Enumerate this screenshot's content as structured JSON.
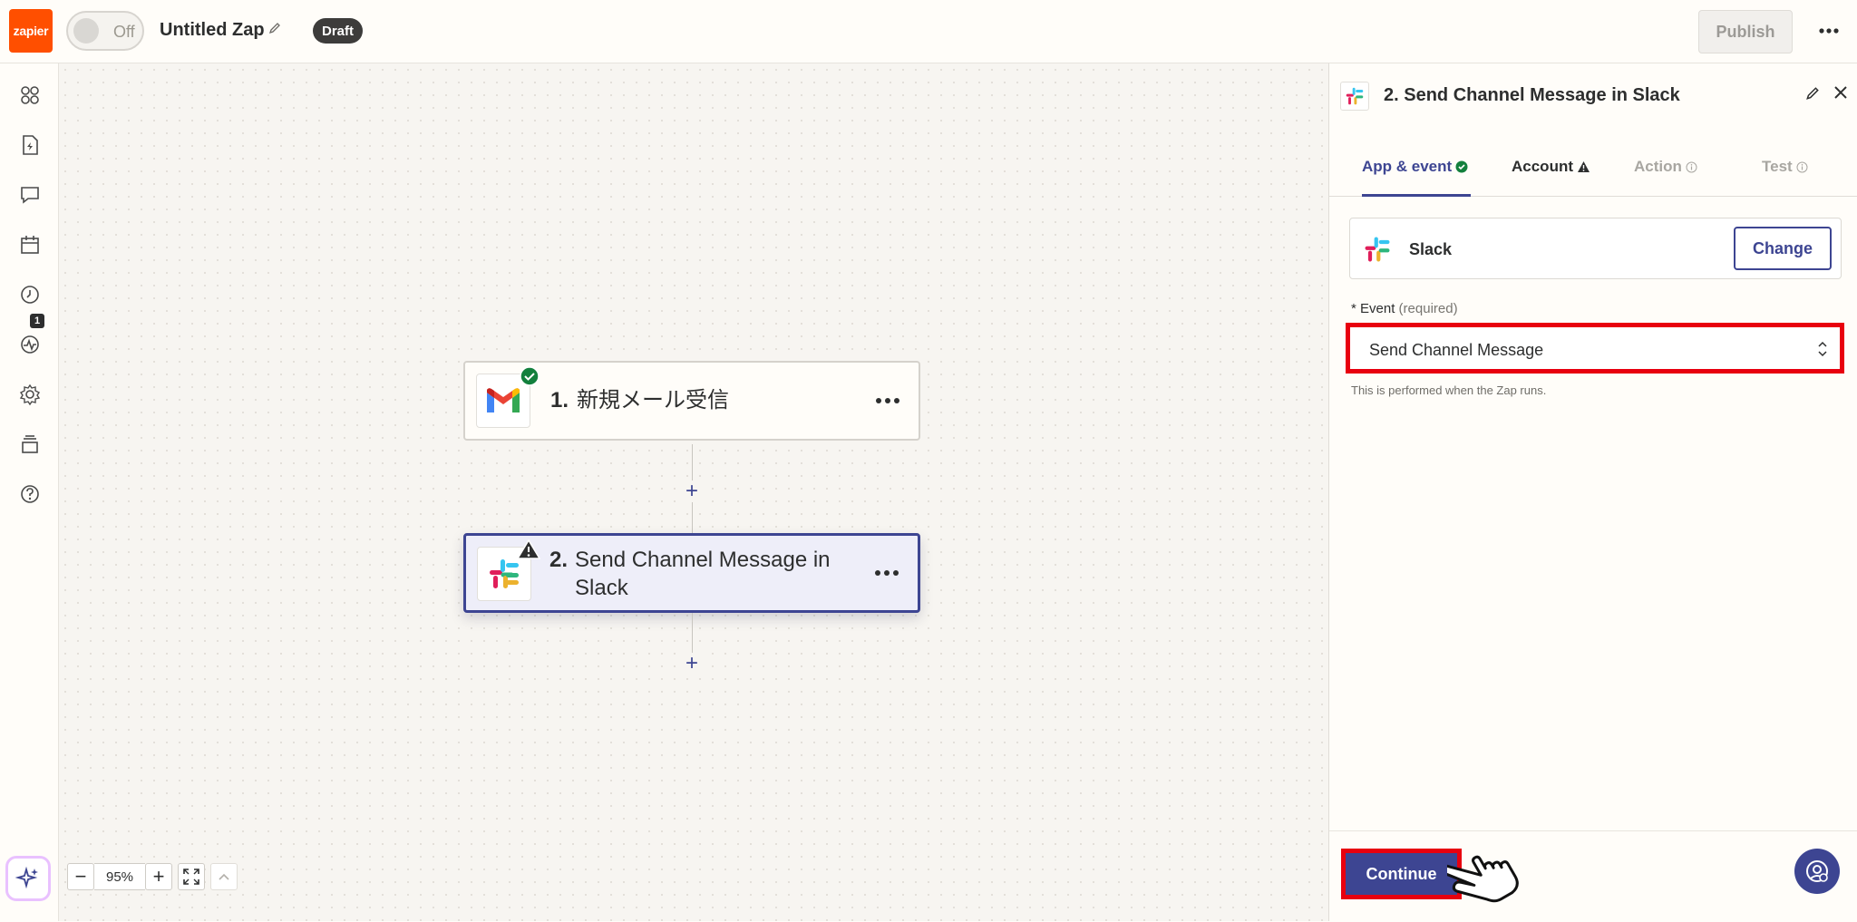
{
  "topbar": {
    "logo_text": "zapier",
    "toggle_label": "Off",
    "zap_title": "Untitled Zap",
    "draft_badge": "Draft",
    "publish_label": "Publish"
  },
  "sidebar": {
    "items": [
      {
        "icon": "apps-grid-icon"
      },
      {
        "icon": "zap-file-icon"
      },
      {
        "icon": "chat-icon"
      },
      {
        "icon": "calendar-icon"
      },
      {
        "icon": "history-icon"
      },
      {
        "icon": "activity-icon",
        "badge": "1"
      },
      {
        "icon": "settings-icon"
      },
      {
        "icon": "layers-icon"
      },
      {
        "icon": "help-icon"
      }
    ],
    "ai_button_icon": "sparkle-icon"
  },
  "canvas": {
    "steps": [
      {
        "number": "1.",
        "title": "新規メール受信",
        "app": "Gmail",
        "status": "check"
      },
      {
        "number": "2.",
        "title_line1": "Send Channel Message in",
        "title_line2": "Slack",
        "app": "Slack",
        "status": "warning"
      }
    ],
    "zoom": {
      "minus": "−",
      "value": "95%",
      "plus": "+"
    }
  },
  "panel": {
    "title": "2. Send Channel Message in Slack",
    "tabs": [
      {
        "label": "App & event",
        "status": "complete"
      },
      {
        "label": "Account",
        "status": "warning"
      },
      {
        "label": "Action",
        "status": "info"
      },
      {
        "label": "Test",
        "status": "info"
      }
    ],
    "app_name": "Slack",
    "change_label": "Change",
    "event_label": "* Event",
    "event_required": "(required)",
    "event_value": "Send Channel Message",
    "event_help": "This is performed when the Zap runs.",
    "continue_label": "Continue"
  },
  "colors": {
    "brand_orange": "#ff4f00",
    "primary": "#3d4592",
    "highlight_red": "#e8000f",
    "success_green": "#13803d"
  }
}
